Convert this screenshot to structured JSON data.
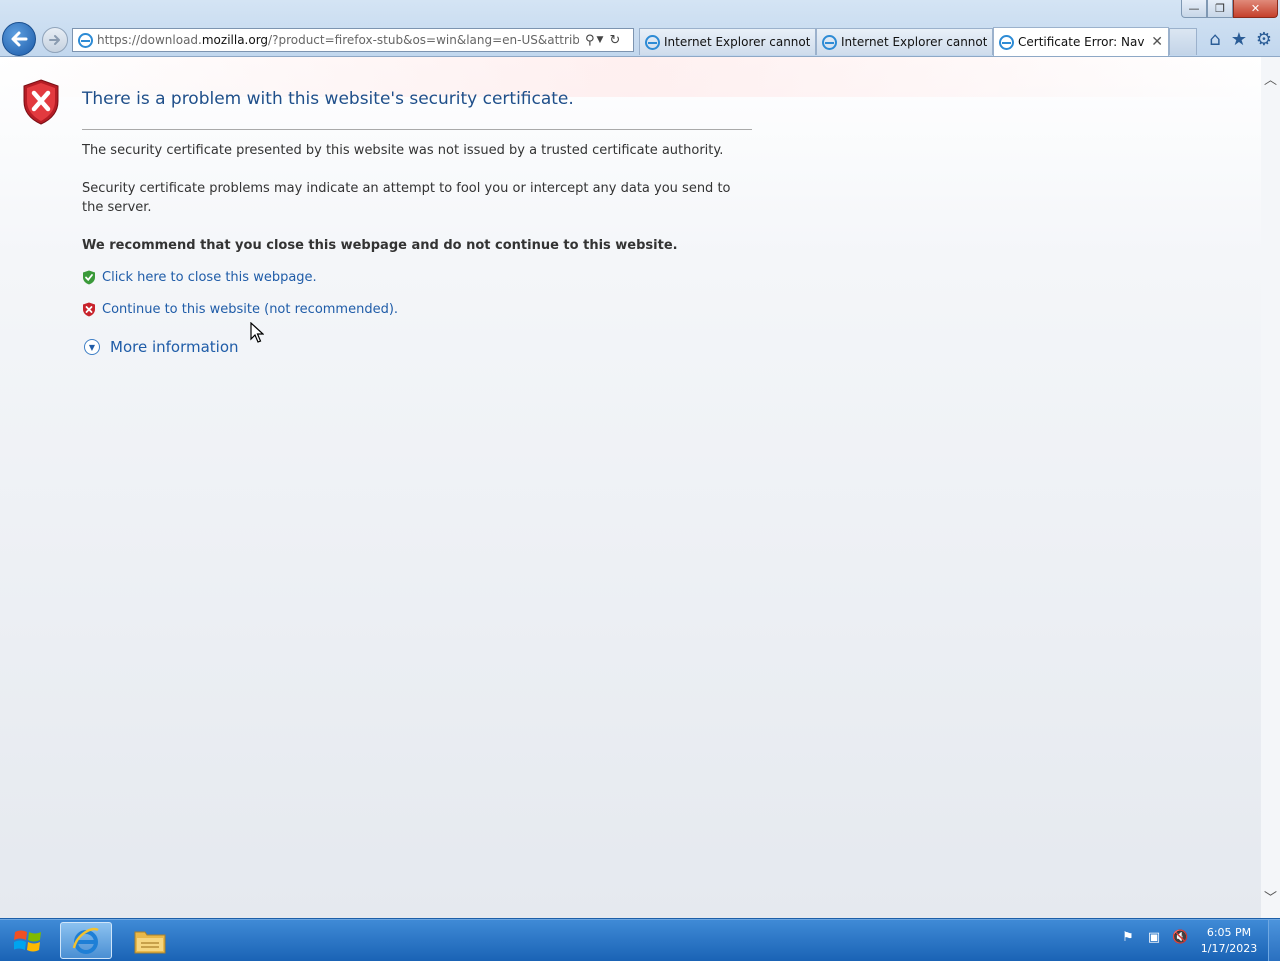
{
  "window": {
    "minimize_glyph": "—",
    "maximize_glyph": "❐",
    "close_glyph": "✕"
  },
  "browser": {
    "address": {
      "prefix": "https://download.",
      "domain": "mozilla.org",
      "suffix": "/?product=firefox-stub&os=win&lang=en-US&attribution_co"
    },
    "tabs": [
      {
        "label": "Internet Explorer cannot di...",
        "active": false
      },
      {
        "label": "Internet Explorer cannot di...",
        "active": false
      },
      {
        "label": "Certificate Error: Navig...",
        "active": true,
        "close": "✕"
      }
    ]
  },
  "page": {
    "headline": "There is a problem with this website's security certificate.",
    "para1": "The security certificate presented by this website was not issued by a trusted certificate authority.",
    "para2": "Security certificate problems may indicate an attempt to fool you or intercept any data you send to the server.",
    "recommend": "We recommend that you close this webpage and do not continue to this website.",
    "close_link": "Click here to close this webpage.",
    "continue_link": "Continue to this website (not recommended).",
    "more_info": "More information"
  },
  "taskbar": {
    "time": "6:05 PM",
    "date": "1/17/2023"
  },
  "colors": {
    "link": "#1f5ca8",
    "headline": "#1f4f8a",
    "error_red": "#c8232c",
    "safe_green": "#3a9a3a",
    "taskbar": "#1a63b5"
  },
  "icons": [
    "back-arrow-icon",
    "forward-arrow-icon",
    "ie-icon",
    "search-icon",
    "refresh-icon",
    "home-icon",
    "favorites-star-icon",
    "tools-gear-icon",
    "error-shield-icon",
    "safe-shield-icon",
    "info-expand-icon",
    "windows-logo-icon",
    "file-explorer-icon",
    "flag-icon",
    "network-icon",
    "volume-muted-icon"
  ]
}
